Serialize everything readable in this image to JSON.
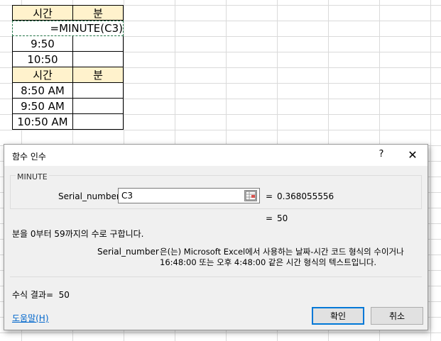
{
  "sheet": {
    "header1": {
      "time": "시간",
      "minute": "분"
    },
    "formula": "=MINUTE(C3)",
    "rows1": [
      {
        "time": "9:50",
        "minute": ""
      },
      {
        "time": "10:50",
        "minute": ""
      }
    ],
    "header2": {
      "time": "시간",
      "minute": "분"
    },
    "rows2": [
      {
        "time": "8:50 AM",
        "minute": ""
      },
      {
        "time": "9:50 AM",
        "minute": ""
      },
      {
        "time": "10:50 AM",
        "minute": ""
      }
    ]
  },
  "dialog": {
    "title": "함수 인수",
    "help_glyph": "?",
    "close_glyph": "✕",
    "function_name": "MINUTE",
    "arg_label": "Serial_number",
    "arg_value": "C3",
    "arg_eq": "=",
    "arg_result": "0.368055556",
    "formula_eq": "=",
    "formula_result": "50",
    "description": "분을 0부터 59까지의 수로 구합니다.",
    "arg_desc_name": "Serial_number",
    "arg_desc_text_line1": "은(는) Microsoft Excel에서 사용하는 날짜-시간 코드 형식의 수이거나",
    "arg_desc_text_line2": "16:48:00 또는 오후 4:48:00 같은 시간 형식의 텍스트입니다.",
    "result_label": "수식 결과=",
    "result_value": "50",
    "help_link": "도움말(H)",
    "ok_label": "확인",
    "cancel_label": "취소"
  },
  "colors": {
    "header_fill": "#fff2cc",
    "copy_border": "#217346",
    "ok_focus": "#0078d7"
  }
}
